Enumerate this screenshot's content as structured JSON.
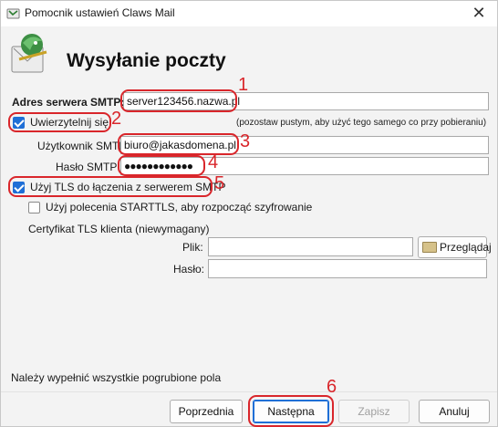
{
  "window": {
    "title": "Pomocnik ustawień Claws Mail",
    "heading": "Wysyłanie poczty"
  },
  "smtp": {
    "server_label": "Adres serwera SMTP:",
    "server_value": "server123456.nazwa.pl",
    "auth_label": "Uwierzytelnij się",
    "auth_checked": true,
    "auth_hint": "(pozostaw pustym, aby użyć tego samego co przy pobieraniu)",
    "user_label": "Użytkownik SMTP:",
    "user_value": "biuro@jakasdomena.pl",
    "password_label": "Hasło SMTP:",
    "password_value": "●●●●●●●●●●●●",
    "tls_label": "Użyj TLS do łączenia z serwerem SMTP",
    "tls_checked": true,
    "starttls_label": "Użyj polecenia STARTTLS, aby rozpocząć szyfrowanie",
    "starttls_checked": false
  },
  "certificate": {
    "section_label": "Certyfikat TLS klienta (niewymagany)",
    "file_label": "Plik:",
    "file_value": "",
    "browse_label": "Przeglądaj",
    "password_label": "Hasło:",
    "password_value": ""
  },
  "annotations": [
    "1",
    "2",
    "3",
    "4",
    "5",
    "6"
  ],
  "footer": {
    "note": "Należy wypełnić wszystkie pogrubione pola",
    "prev_label": "Poprzednia",
    "next_label": "Następna",
    "save_label": "Zapisz",
    "cancel_label": "Anuluj"
  },
  "colors": {
    "annotation_red": "#d9262b",
    "accent_blue": "#1f6fd6"
  }
}
